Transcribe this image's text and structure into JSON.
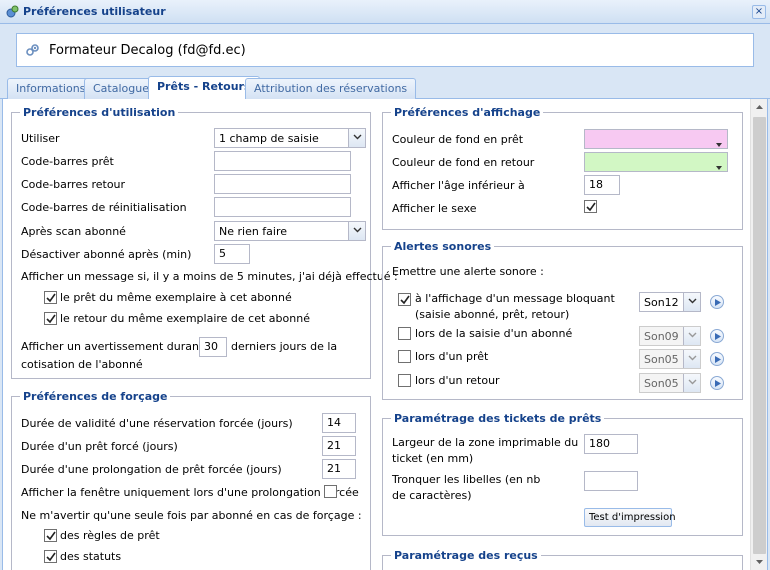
{
  "window": {
    "title": "Préférences utilisateur",
    "close_label": "×"
  },
  "user": {
    "name": "Formateur Decalog (fd@fd.ec)"
  },
  "tabs": [
    {
      "label": "Informations"
    },
    {
      "label": "Catalogue"
    },
    {
      "label": "Prêts - Retours"
    },
    {
      "label": "Attribution des réservations"
    }
  ],
  "usage": {
    "legend": "Préférences d'utilisation",
    "utiliser_label": "Utiliser",
    "utiliser_value": "1 champ de saisie",
    "cb_pret_label": "Code-barres prêt",
    "cb_pret_value": "",
    "cb_retour_label": "Code-barres retour",
    "cb_retour_value": "",
    "cb_reinit_label": "Code-barres de réinitialisation",
    "cb_reinit_value": "",
    "apres_scan_label": "Après scan abonné",
    "apres_scan_value": "Ne rien faire",
    "desactiver_label": "Désactiver abonné après (min)",
    "desactiver_value": "5",
    "message_label": "Afficher un message si, il y a moins de 5 minutes, j'ai déjà effectué :",
    "opt_pret_label": "le prêt du même exemplaire à cet abonné",
    "opt_retour_label": "le retour du même exemplaire de cet abonné",
    "avert_label_a": "Afficher un avertissement durant les",
    "avert_value": "30",
    "avert_label_b": "derniers jours de la",
    "avert_label_c": "cotisation de l'abonné"
  },
  "forcage": {
    "legend": "Préférences de forçage",
    "validite_label": "Durée de validité d'une réservation forcée (jours)",
    "validite_value": "14",
    "pret_force_label": "Durée d'un prêt forcé (jours)",
    "pret_force_value": "21",
    "prolong_label": "Durée d'une prolongation de prêt forcée (jours)",
    "prolong_value": "21",
    "fenetre_label": "Afficher la fenêtre uniquement lors d'une prolongation forcée",
    "avertir_label": "Ne m'avertir qu'une seule fois par abonné en cas de forçage :",
    "regles_label": "des règles de prêt",
    "statuts_label": "des statuts"
  },
  "affichage": {
    "legend": "Préférences d'affichage",
    "fond_pret_label": "Couleur de fond en prêt",
    "fond_pret_color": "#f7c9f2",
    "fond_retour_label": "Couleur de fond en retour",
    "fond_retour_color": "#d2f7c4",
    "age_label": "Afficher l'âge inférieur à",
    "age_value": "18",
    "sexe_label": "Afficher le sexe"
  },
  "alertes": {
    "legend": "Alertes sonores",
    "intro": "Emettre une alerte sonore :",
    "items": [
      {
        "label": "à l'affichage d'un message bloquant (saisie abonné, prêt, retour)",
        "sound": "Son12"
      },
      {
        "label": "lors de la saisie d'un abonné",
        "sound": "Son09"
      },
      {
        "label": "lors d'un prêt",
        "sound": "Son05"
      },
      {
        "label": "lors d'un retour",
        "sound": "Son05"
      }
    ]
  },
  "tickets": {
    "legend": "Paramétrage des tickets de prêts",
    "largeur_label": "Largeur de la zone imprimable du ticket (en mm)",
    "largeur_value": "180",
    "tronquer_label": "Tronquer les libelles (en nb de caractères)",
    "tronquer_value": "",
    "test_button": "Test d'impression"
  },
  "recus": {
    "legend": "Paramétrage des reçus"
  }
}
